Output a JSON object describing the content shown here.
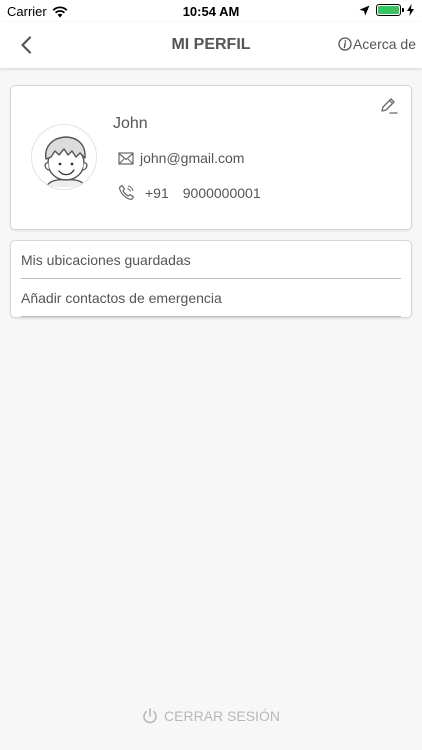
{
  "status_bar": {
    "carrier": "Carrier",
    "time": "10:54 AM",
    "battery_color": "#34c759"
  },
  "nav": {
    "back_icon": "chevron-left-icon",
    "title": "MI PERFIL",
    "about_icon": "info-icon",
    "about_label": "Acerca de"
  },
  "profile": {
    "name": "John",
    "email": "john@gmail.com",
    "phone_code": "+91",
    "phone_number": "9000000001",
    "edit_icon": "pencil-icon",
    "email_icon": "mail-icon",
    "phone_icon": "phone-icon"
  },
  "menu": {
    "items": [
      {
        "label": "Mis ubicaciones guardadas"
      },
      {
        "label": "Añadir contactos de emergencia"
      }
    ]
  },
  "logout": {
    "icon": "power-icon",
    "label": "CERRAR SESIÓN",
    "color": "#b8b8b8"
  }
}
